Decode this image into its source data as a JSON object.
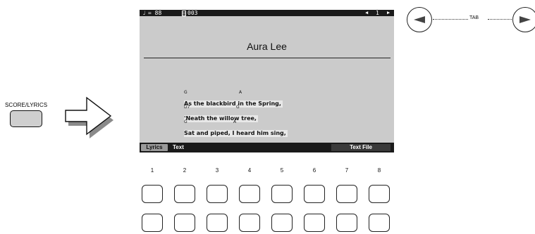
{
  "panel": {
    "score_lyrics_label": "SCORE/LYRICS"
  },
  "screen": {
    "topbar": {
      "note_symbol": "♩",
      "tempo": "= 88",
      "measure": "003",
      "page_indicator": "1"
    },
    "song_title": "Aura Lee",
    "lyrics": [
      {
        "chords": [
          "G",
          "A"
        ],
        "line": "As the blackbird in the Spring,"
      },
      {
        "chords": [
          "D7",
          "G"
        ],
        "line": "'Neath the willow tree,"
      },
      {
        "chords": [
          "G",
          "A"
        ],
        "line": "Sat and piped, I heard him sing,"
      }
    ],
    "bottombar": {
      "tab_lyrics": "Lyrics",
      "tab_text": "Text",
      "text_file": "Text File"
    }
  },
  "tab_control": {
    "label": "TAB"
  },
  "buttons": {
    "numbers": [
      "1",
      "2",
      "3",
      "4",
      "5",
      "6",
      "7",
      "8"
    ]
  }
}
